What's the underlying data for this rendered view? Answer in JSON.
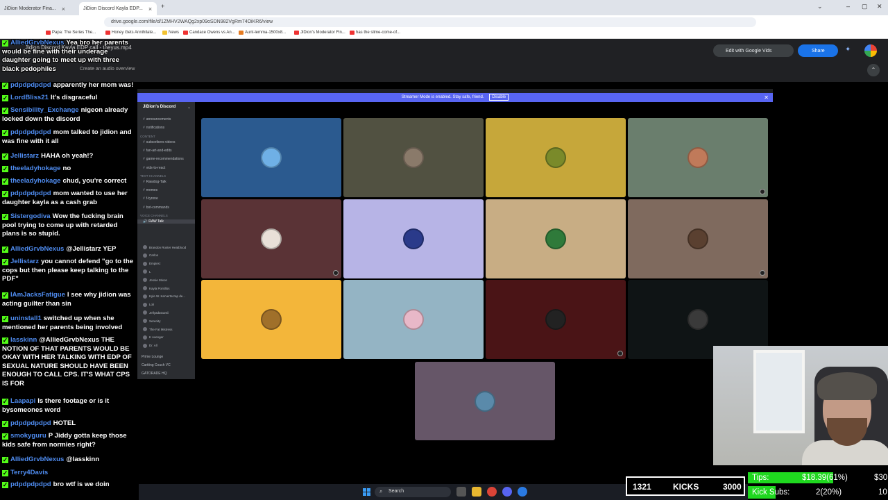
{
  "browser": {
    "tabs": [
      {
        "label": "JiDion Moderator Fina..."
      },
      {
        "label": "JiDion Discord Kayla EDP..."
      }
    ],
    "url": "drive.google.com/file/d/1ZMHV2WAQg2xp09oSDN982VgRm74OiKR6/view",
    "bookmarks": [
      "Papa: The Series The...",
      "Honey Gets Annihilate...",
      "News",
      "Candace Owens vs An...",
      "Aunt-lemma-1500x8...",
      "JiDion's Moderator Fin...",
      "has the slime-come-of..."
    ]
  },
  "drive": {
    "file_title": "Jidion Discord Kayla EDP call - theyus.mp4",
    "overview_label": "Create an audio overview",
    "edit_button": "Edit with Google Vids",
    "share_button": "Share"
  },
  "discord": {
    "streamer_notice": "Streamer Mode is enabled. Stay safe, friend.",
    "disable_label": "Disable",
    "server_name": "JiDion's Discord",
    "channels": [
      {
        "label": "announcements",
        "type": "channel"
      },
      {
        "label": "notifications",
        "type": "channel"
      },
      {
        "label": "CONTENT",
        "type": "category"
      },
      {
        "label": "subscribers-videos",
        "type": "channel"
      },
      {
        "label": "fan-art-and-edits",
        "type": "channel"
      },
      {
        "label": "game-recommendations",
        "type": "channel"
      },
      {
        "label": "vids-to-react",
        "type": "channel"
      },
      {
        "label": "TEXT CHANNELS",
        "type": "category"
      },
      {
        "label": "Rawdog-Talk",
        "type": "channel"
      },
      {
        "label": "memes",
        "type": "channel"
      },
      {
        "label": "f-tyrone",
        "type": "channel"
      },
      {
        "label": "bot-commands",
        "type": "channel"
      },
      {
        "label": "VOICE CHANNELS",
        "type": "category"
      },
      {
        "label": "RAW Talk",
        "type": "active"
      }
    ],
    "voice_users": [
      "Brandon Roster Heatblood",
      "Carlos",
      "Empirez",
      "L",
      "Jessie Mixon",
      "Kayla Pontillos",
      "Kyle W. Kervertscrap de...",
      "Loli",
      "JellyadaGamii",
      "Serenity",
      "The Fat Mistress",
      "K Avenger",
      "Dr. All"
    ],
    "bottom_channels": [
      "Prime Lounge",
      "Cartting Couch VC",
      "GATORADE HQ"
    ]
  },
  "chat": [
    {
      "user": "AlliedGrvbNexus",
      "text": "Yea bro her parents would be fine with their underage daughter going to meet up with three black pedophiles",
      "color": "#4f8cf0"
    },
    {
      "user": "pdpdpdpdpd",
      "text": "apparently her mom was!",
      "color": "#4f8cf0"
    },
    {
      "user": "LordBliss21",
      "text": "It's disgraceful",
      "color": "#4f8cf0"
    },
    {
      "user": "Sensibility_Exchange",
      "text": "nigeon already locked down the discord",
      "color": "#4f8cf0"
    },
    {
      "user": "pdpdpdpdpd",
      "text": "mom talked to jidion and was fine with it all",
      "color": "#4f8cf0"
    },
    {
      "user": "Jellistarz",
      "text": "HAHA oh yeah!?",
      "color": "#4f8cf0"
    },
    {
      "user": "theeladyhokage",
      "text": "no",
      "color": "#4f8cf0"
    },
    {
      "user": "theeladyhokage",
      "text": "chud, you're correct",
      "color": "#4f8cf0"
    },
    {
      "user": "pdpdpdpdpd",
      "text": "mom wanted to use her daughter kayla as a cash grab",
      "color": "#4f8cf0"
    },
    {
      "user": "Sistergodiva",
      "text": "Wow the fucking brain pool trying to come up with retarded plans is so stupid.",
      "color": "#4f8cf0"
    },
    {
      "user": "AlliedGrvbNexus",
      "text": "@Jellistarz YEP",
      "color": "#4f8cf0"
    },
    {
      "user": "Jellistarz",
      "text": "you cannot defend \"go to the cops but then please keep talking to the PDF\"",
      "color": "#4f8cf0"
    },
    {
      "user": "IAmJacksFatigue",
      "text": "I see why jidion was acting guilter than sin",
      "color": "#4f8cf0"
    },
    {
      "user": "uninstall1",
      "text": "switched up when she mentioned her parents being involved",
      "color": "#4f8cf0"
    },
    {
      "user": "lasskinn",
      "text": "@AlliedGrvbNexus THE NOTION OF THAT PARENTS WOULD BE OKAY WITH HER TALKING WITH EDP OF SEXUAL NATURE SHOULD HAVE BEEN ENOUGH TO CALL CPS. IT'S WHAT CPS IS FOR",
      "color": "#4f8cf0"
    },
    {
      "user": "Laapapi",
      "text": "Is there footage or is it bysomeones word",
      "color": "#4f8cf0"
    },
    {
      "user": "pdpdpdpdpd",
      "text": "HOTEL",
      "color": "#4f8cf0"
    },
    {
      "user": "smokyguru",
      "text": "P Jiddy gotta keep those kids safe from normies right?",
      "color": "#4f8cf0"
    },
    {
      "user": "AlliedGrvbNexus",
      "text": "@lasskinn",
      "color": "#4f8cf0"
    },
    {
      "user": "Terry4Davis",
      "text": "",
      "color": "#4f8cf0"
    },
    {
      "user": "pdpdpdpdpd",
      "text": "bro wtf is we doin",
      "color": "#4f8cf0"
    }
  ],
  "stats": {
    "kicks_current": "1321",
    "kicks_label": "KICKS",
    "kicks_goal": "3000",
    "kicks_fill_fraction": 0.44,
    "tips_label": "Tips:",
    "tips_value": "$18.39(61%)",
    "tips_goal": "$30",
    "tips_fraction": 0.61,
    "subs_label": "Kick Subs:",
    "subs_value": "2(20%)",
    "subs_goal": "10",
    "subs_fraction": 0.2
  },
  "taskbar": {
    "search_label": "Search"
  },
  "colors": {
    "kick_green": "#53fc18",
    "discord_blurple": "#5865f2",
    "chat_username": "#4f8cf0"
  }
}
